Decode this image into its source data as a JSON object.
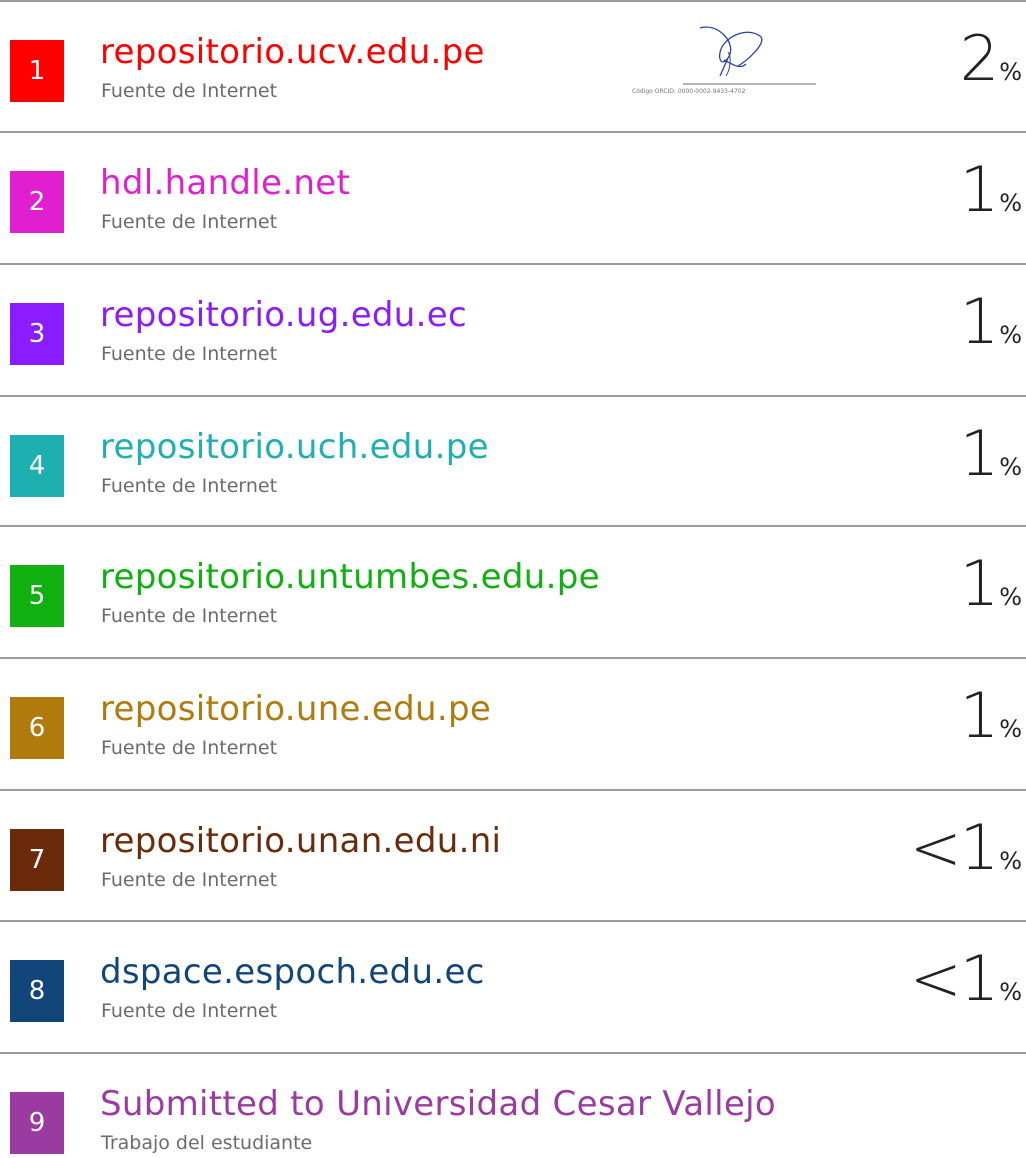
{
  "sources": [
    {
      "num": "1",
      "title": "repositorio.ucv.edu.pe",
      "type": "Fuente de Internet",
      "pct": "2",
      "unit": "%",
      "color": "#ff0000"
    },
    {
      "num": "2",
      "title": "hdl.handle.net",
      "type": "Fuente de Internet",
      "pct": "1",
      "unit": "%",
      "color": "#e020d0"
    },
    {
      "num": "3",
      "title": "repositorio.ug.edu.ec",
      "type": "Fuente de Internet",
      "pct": "1",
      "unit": "%",
      "color": "#8a1cff"
    },
    {
      "num": "4",
      "title": "repositorio.uch.edu.pe",
      "type": "Fuente de Internet",
      "pct": "1",
      "unit": "%",
      "color": "#1eb0b0"
    },
    {
      "num": "5",
      "title": "repositorio.untumbes.edu.pe",
      "type": "Fuente de Internet",
      "pct": "1",
      "unit": "%",
      "color": "#10b010"
    },
    {
      "num": "6",
      "title": "repositorio.une.edu.pe",
      "type": "Fuente de Internet",
      "pct": "1",
      "unit": "%",
      "color": "#b07a0c"
    },
    {
      "num": "7",
      "title": "repositorio.unan.edu.ni",
      "type": "Fuente de Internet",
      "pct": "<1",
      "unit": "%",
      "color": "#6b2a0a"
    },
    {
      "num": "8",
      "title": "dspace.espoch.edu.ec",
      "type": "Fuente de Internet",
      "pct": "<1",
      "unit": "%",
      "color": "#12457a"
    },
    {
      "num": "9",
      "title": "Submitted to Universidad Cesar Vallejo",
      "type": "Trabajo del estudiante",
      "pct": "",
      "unit": "",
      "color": "#9b3aa0"
    }
  ],
  "signature": {
    "caption": "Código ORCID: 0000-0002-9433-4702"
  }
}
